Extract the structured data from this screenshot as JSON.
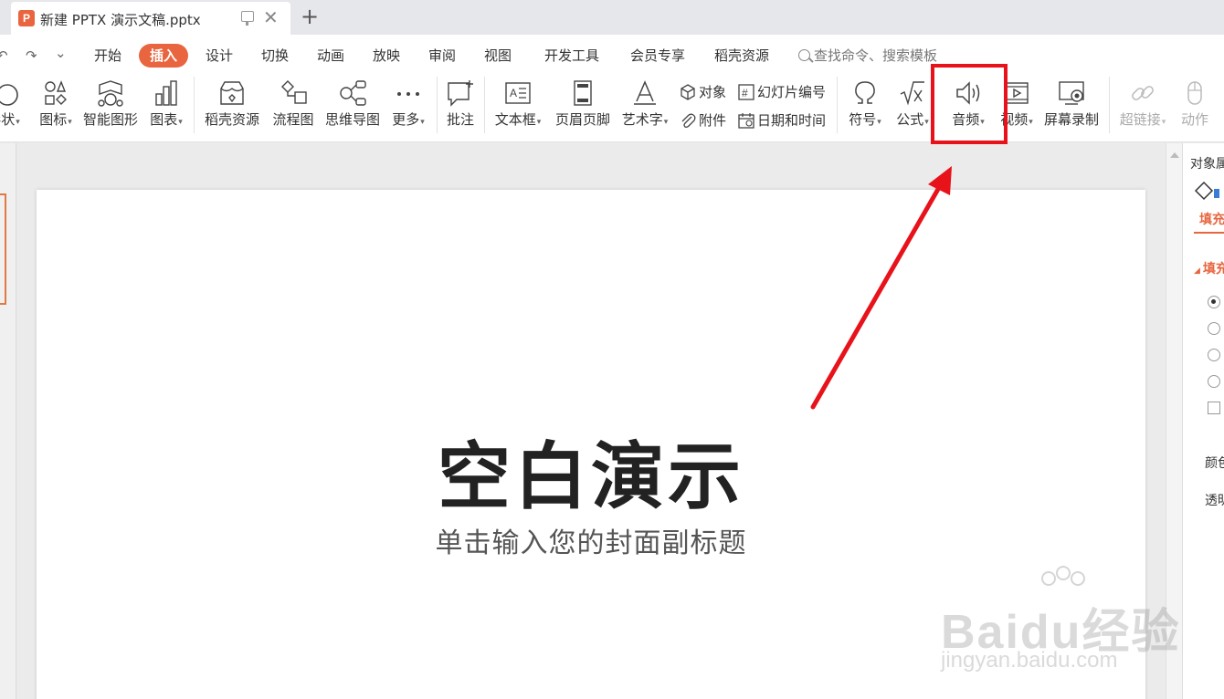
{
  "titlebar": {
    "doc_logo": "P",
    "doc_name": "新建 PPTX 演示文稿.pptx",
    "close_glyph": "✕",
    "new_tab_glyph": "+"
  },
  "quick_access": {
    "undo": "↶",
    "redo": "↷",
    "more": "⌄"
  },
  "menu": {
    "items": [
      "开始",
      "插入",
      "设计",
      "切换",
      "动画",
      "放映",
      "审阅",
      "视图",
      "开发工具",
      "会员专享",
      "稻壳资源"
    ],
    "active": "插入",
    "search_placeholder": "查找命令、搜索模板"
  },
  "toolbar": {
    "shape": "形状",
    "icon": "图标",
    "smartart": "智能图形",
    "chart": "图表",
    "docer": "稻壳资源",
    "flowchart": "流程图",
    "mindmap": "思维导图",
    "more": "更多",
    "comment": "批注",
    "textbox": "文本框",
    "header_footer": "页眉页脚",
    "wordart": "艺术字",
    "object": "对象",
    "slide_number": "幻灯片编号",
    "attachment": "附件",
    "datetime": "日期和时间",
    "symbol": "符号",
    "formula": "公式",
    "audio": "音频",
    "video": "视频",
    "screen_record": "屏幕录制",
    "hyperlink": "超链接",
    "action": "动作",
    "caret": "▾"
  },
  "slide": {
    "title": "空白演示",
    "subtitle": "单击输入您的封面副标题"
  },
  "right_pane": {
    "title": "对象属",
    "tab": "填充",
    "section": "填充",
    "color_label": "颜色",
    "transparency_label": "透明"
  },
  "watermark": {
    "main": "Baidu经验",
    "url": "jingyan.baidu.com"
  },
  "colors": {
    "accent": "#e8653f",
    "highlight": "#e8121a",
    "arrow": "#e8121a"
  }
}
